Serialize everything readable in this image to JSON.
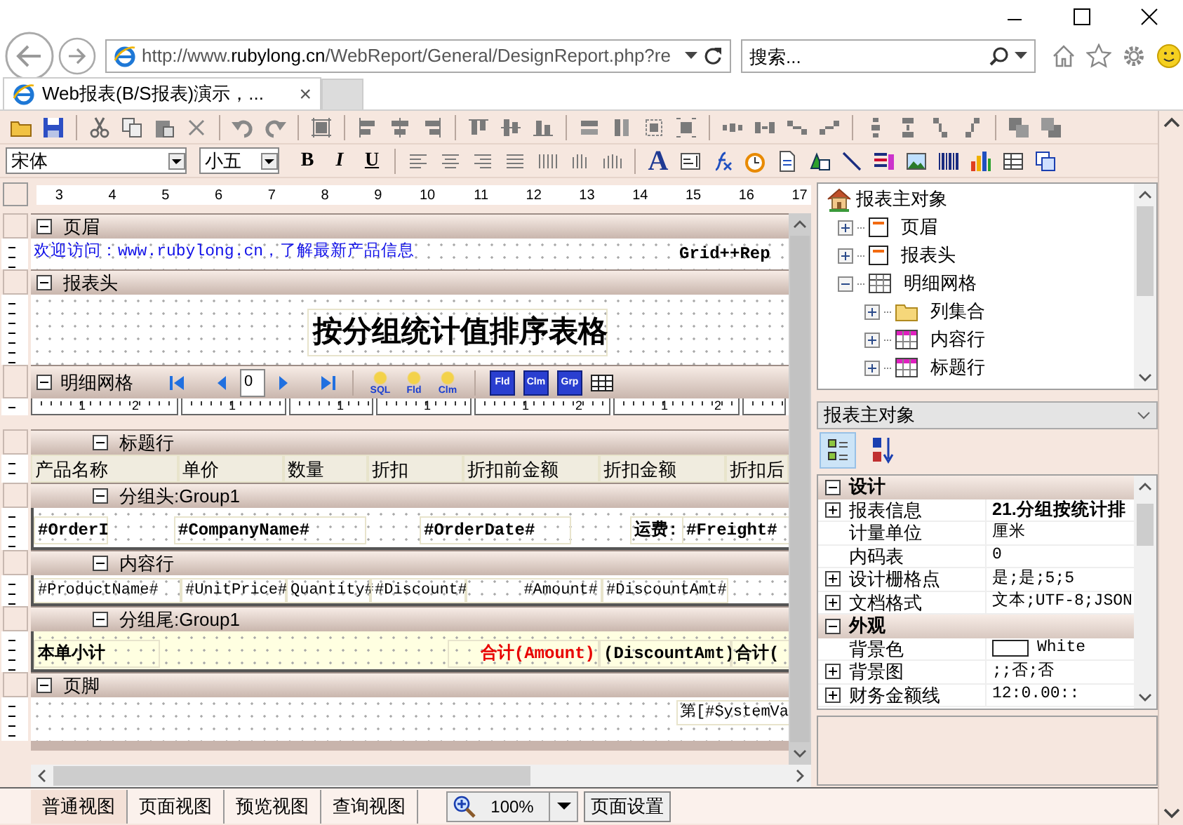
{
  "browser": {
    "address": {
      "scheme_host": "http://www.",
      "domain": "rubylong.cn",
      "path": "/WebReport/General/DesignReport.php?re"
    },
    "search": {
      "placeholder": "搜索..."
    },
    "tabs": [
      {
        "title": "Web报表(B/S报表)演示，...",
        "selected": true,
        "close": "×"
      }
    ]
  },
  "toolbar": {
    "font": "宋体",
    "font_size": "小五",
    "format_buttons": [
      "B",
      "I",
      "U"
    ],
    "text_tool": "A"
  },
  "designer": {
    "ruler": [
      "3",
      "4",
      "5",
      "6",
      "7",
      "8",
      "9",
      "10",
      "11",
      "12",
      "13",
      "14",
      "15",
      "16",
      "17"
    ],
    "sections": [
      {
        "kind": "band",
        "title": "页眉",
        "expanded": true,
        "cells": [
          {
            "text": "欢迎访问：www.rubylong.cn，了解最新产品信息",
            "kind": "link"
          },
          {
            "text": "Grid++Rep",
            "kind": "bold"
          }
        ]
      },
      {
        "kind": "band",
        "title": "报表头",
        "expanded": true,
        "cells": [
          {
            "text": "按分组统计值排序表格",
            "kind": "title"
          }
        ]
      },
      {
        "kind": "grid",
        "title": "明细网格",
        "expanded": true,
        "page": "0",
        "tools": [
          "SQL",
          "Fld",
          "Clm"
        ],
        "tools_2": [
          "Fld",
          "Clm",
          "Grp"
        ],
        "column_ruler": [
          [
            "1",
            "2"
          ],
          [
            "1"
          ],
          [
            "1"
          ],
          [
            "1"
          ],
          [
            "1",
            "2"
          ],
          [
            "1",
            "2"
          ]
        ]
      },
      {
        "kind": "grid-band",
        "title": "标题行",
        "expanded": true,
        "cells": [
          {
            "text": "产品名称",
            "kind": "header"
          },
          {
            "text": "单价",
            "kind": "header"
          },
          {
            "text": "数量",
            "kind": "header"
          },
          {
            "text": "折扣",
            "kind": "header"
          },
          {
            "text": "折扣前金额",
            "kind": "header"
          },
          {
            "text": "折扣金额",
            "kind": "header"
          },
          {
            "text": "折扣后",
            "kind": "header"
          }
        ]
      },
      {
        "kind": "grid-band",
        "title": "分组头:Group1",
        "expanded": true,
        "cells": [
          {
            "text": "#OrderI",
            "kind": "field"
          },
          {
            "text": "#CompanyName#",
            "kind": "field"
          },
          {
            "text": "#OrderDate#",
            "kind": "field"
          },
          {
            "text": "运费:",
            "kind": "field"
          },
          {
            "text": "#Freight#",
            "kind": "field"
          }
        ]
      },
      {
        "kind": "grid-band",
        "title": "内容行",
        "expanded": true,
        "cells": [
          {
            "text": "#ProductName#",
            "kind": "plain"
          },
          {
            "text": "#UnitPrice#",
            "kind": "plain-right"
          },
          {
            "text": "Quantity#",
            "kind": "plain-right"
          },
          {
            "text": "#Discount#",
            "kind": "plain-right"
          },
          {
            "text": "#Amount#",
            "kind": "plain-right"
          },
          {
            "text": "#DiscountAmt#",
            "kind": "plain-right"
          }
        ]
      },
      {
        "kind": "grid-band",
        "title": "分组尾:Group1",
        "expanded": true,
        "cells": [
          {
            "text": "本单小计",
            "kind": "field"
          },
          {
            "text": "合计(Amount)",
            "kind": "sum"
          },
          {
            "text": "(DiscountAmt)",
            "kind": "field"
          },
          {
            "text": "合计(",
            "kind": "field"
          }
        ]
      },
      {
        "kind": "band",
        "title": "页脚",
        "expanded": true,
        "cells": [
          {
            "text": "第[#SystemVa",
            "kind": "plain"
          }
        ]
      }
    ]
  },
  "object_tree": {
    "root": "报表主对象",
    "items": [
      {
        "label": "页眉",
        "kind": "band",
        "expanded": false
      },
      {
        "label": "报表头",
        "kind": "band",
        "expanded": false
      },
      {
        "label": "明细网格",
        "kind": "grid",
        "expanded": true,
        "children": [
          {
            "label": "列集合",
            "kind": "folder",
            "expanded": false
          },
          {
            "label": "内容行",
            "kind": "row",
            "expanded": false
          },
          {
            "label": "标题行",
            "kind": "row",
            "expanded": false
          }
        ]
      }
    ]
  },
  "property_panel": {
    "object": "报表主对象",
    "view_buttons": [
      {
        "kind": "categorized",
        "selected": true
      },
      {
        "kind": "alphabetical",
        "selected": false
      }
    ],
    "categories": [
      {
        "title": "设计",
        "expanded": true,
        "rows": [
          {
            "name": "报表信息",
            "value": "21.分组按统计排",
            "expandable": true,
            "bold": true
          },
          {
            "name": "计量单位",
            "value": "厘米",
            "expandable": false,
            "bold": false
          },
          {
            "name": "内码表",
            "value": "0",
            "expandable": false,
            "bold": false
          },
          {
            "name": "设计栅格点",
            "value": "是;是;5;5",
            "expandable": true,
            "bold": false
          },
          {
            "name": "文档格式",
            "value": "文本;UTF-8;JSON",
            "expandable": true,
            "bold": false
          }
        ]
      },
      {
        "title": "外观",
        "expanded": true,
        "rows": [
          {
            "name": "背景色",
            "value": "White",
            "expandable": false,
            "bold": false,
            "kind": "color",
            "color": "#ffffff"
          },
          {
            "name": "背景图",
            "value": ";;否;否",
            "expandable": true,
            "bold": false
          },
          {
            "name": "财务金额线",
            "value": "12:0.00::",
            "expandable": true,
            "bold": false
          }
        ]
      }
    ]
  },
  "bottom_bar": {
    "view_tabs": [
      {
        "label": "普通视图",
        "selected": true
      },
      {
        "label": "页面视图",
        "selected": false
      },
      {
        "label": "预览视图",
        "selected": false
      },
      {
        "label": "查询视图",
        "selected": false
      }
    ],
    "zoom": "100%",
    "page_setup": "页面设置"
  }
}
